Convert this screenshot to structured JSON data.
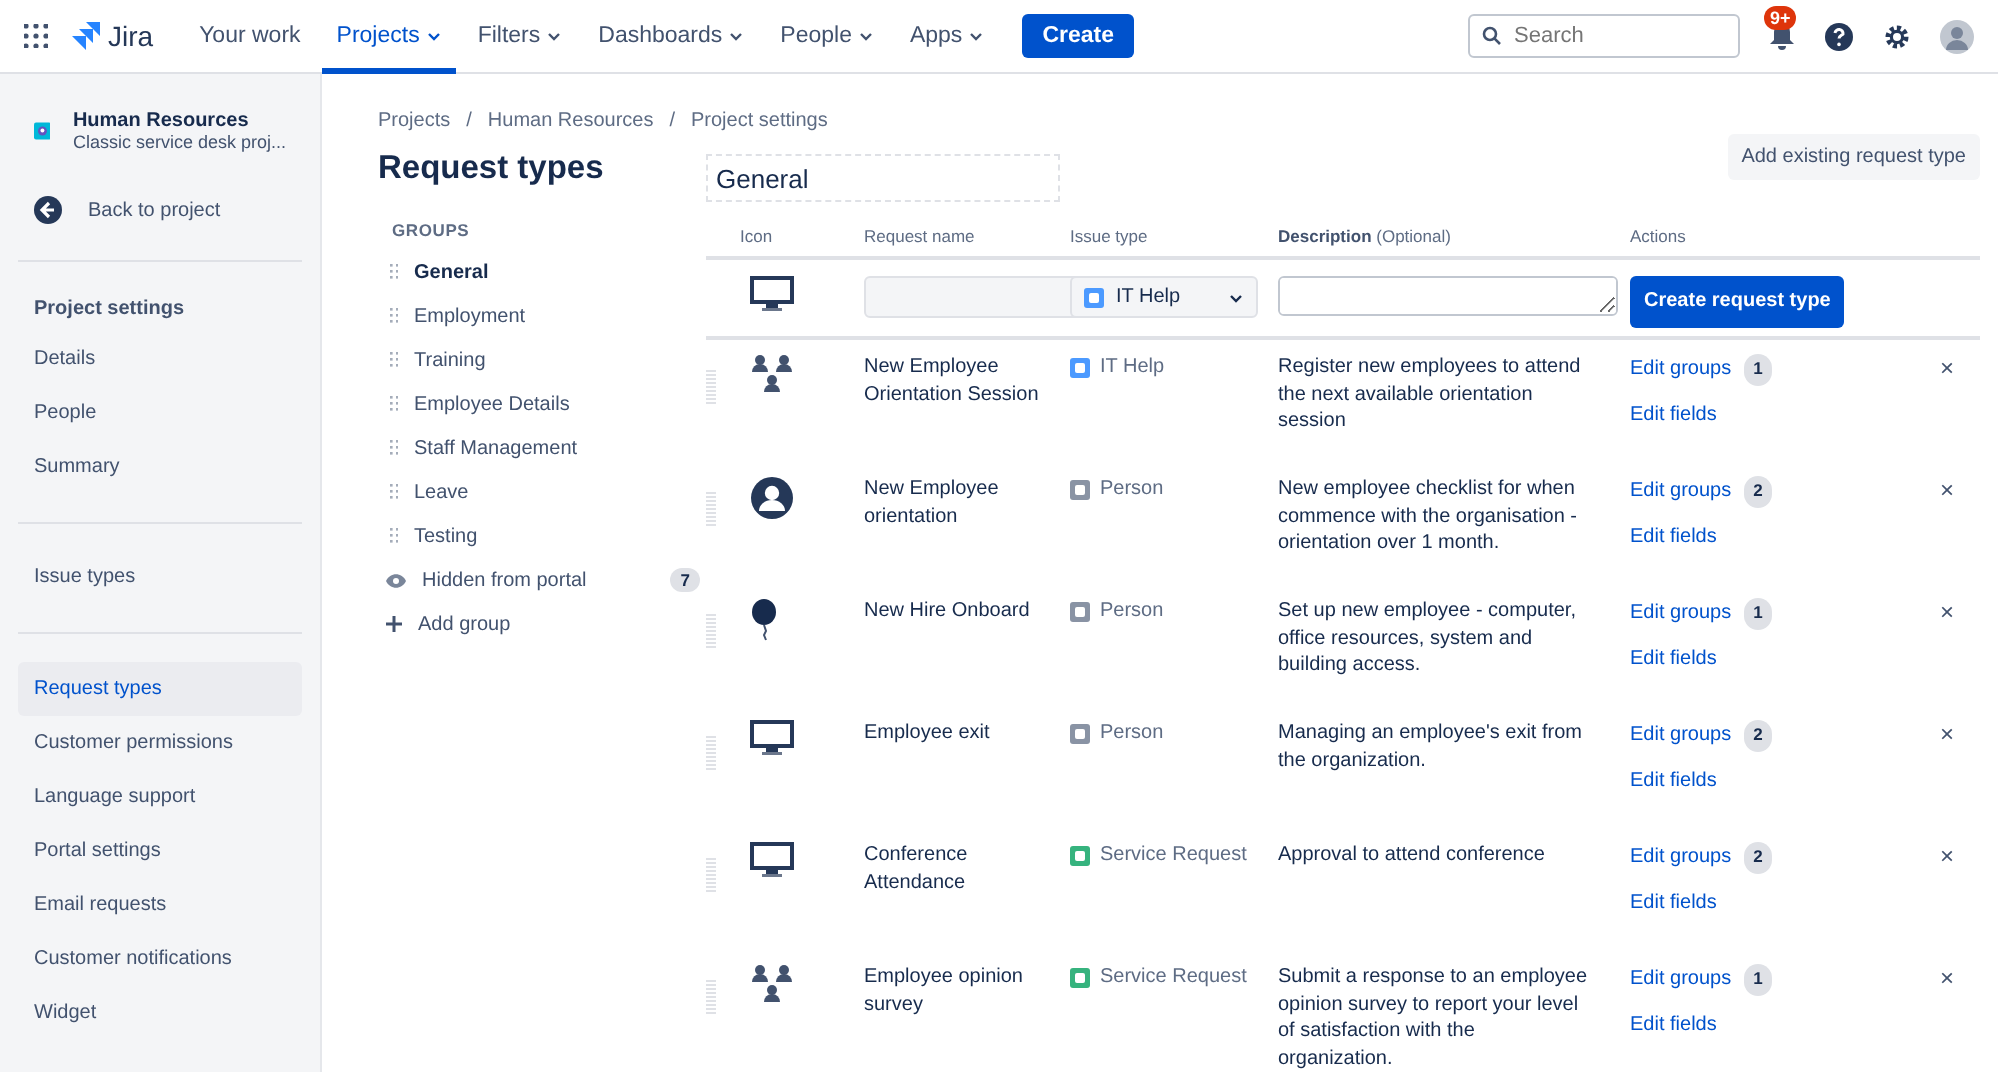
{
  "nav": {
    "logo": "Jira",
    "items": [
      {
        "label": "Your work",
        "selected": false,
        "dropdown": false
      },
      {
        "label": "Projects",
        "selected": true,
        "dropdown": true
      },
      {
        "label": "Filters",
        "selected": false,
        "dropdown": true
      },
      {
        "label": "Dashboards",
        "selected": false,
        "dropdown": true
      },
      {
        "label": "People",
        "selected": false,
        "dropdown": true
      },
      {
        "label": "Apps",
        "selected": false,
        "dropdown": true
      }
    ],
    "create": "Create",
    "search": {
      "placeholder": "Search"
    },
    "notifications_badge": "9+"
  },
  "sidebar": {
    "project": {
      "name": "Human Resources",
      "type": "Classic service desk proj..."
    },
    "back": "Back to project",
    "heading": "Project settings",
    "sections": [
      [
        {
          "label": "Details",
          "selected": false
        },
        {
          "label": "People",
          "selected": false
        },
        {
          "label": "Summary",
          "selected": false
        }
      ],
      [
        {
          "label": "Issue types",
          "selected": false
        }
      ],
      [
        {
          "label": "Request types",
          "selected": true
        },
        {
          "label": "Customer permissions",
          "selected": false
        },
        {
          "label": "Language support",
          "selected": false
        },
        {
          "label": "Portal settings",
          "selected": false
        },
        {
          "label": "Email requests",
          "selected": false
        },
        {
          "label": "Customer notifications",
          "selected": false
        },
        {
          "label": "Widget",
          "selected": false
        }
      ]
    ]
  },
  "breadcrumbs": {
    "separator": "/",
    "items": [
      "Projects",
      "Human Resources",
      "Project settings"
    ]
  },
  "title": "Request types",
  "groups": {
    "heading": "GROUPS",
    "items": [
      {
        "label": "General",
        "selected": true
      },
      {
        "label": "Employment",
        "selected": false
      },
      {
        "label": "Training",
        "selected": false
      },
      {
        "label": "Employee Details",
        "selected": false
      },
      {
        "label": "Staff Management",
        "selected": false
      },
      {
        "label": "Leave",
        "selected": false
      },
      {
        "label": "Testing",
        "selected": false
      }
    ],
    "hidden": {
      "label": "Hidden from portal",
      "count": "7"
    },
    "add": "Add group"
  },
  "group_name": "General",
  "add_existing": "Add existing request type",
  "table": {
    "columns": {
      "icon": "Icon",
      "name": "Request name",
      "issue_type": "Issue type",
      "description": "Description",
      "description_hint": "(Optional)",
      "actions": "Actions"
    },
    "new_row": {
      "kind": "monitor",
      "issue_type": {
        "label": "IT Help",
        "color": "#4c9aff"
      },
      "create": "Create request type"
    },
    "rows": [
      {
        "kind": "people",
        "name": "New Employee Orientation Session",
        "issue_type": {
          "label": "IT Help",
          "color": "#4c9aff"
        },
        "description": "Register new employees to attend the next available orientation session",
        "edit_groups": "Edit groups",
        "count": "1",
        "edit_fields": "Edit fields",
        "remove": "×"
      },
      {
        "kind": "avatar",
        "name": "New Employee orientation",
        "issue_type": {
          "label": "Person",
          "color": "#8993a4"
        },
        "description": "New employee checklist for when commence with the organisation - orientation over 1 month.",
        "edit_groups": "Edit groups",
        "count": "2",
        "edit_fields": "Edit fields",
        "remove": "×"
      },
      {
        "kind": "balloon",
        "name": "New Hire Onboard",
        "issue_type": {
          "label": "Person",
          "color": "#8993a4"
        },
        "description": "Set up new employee - computer, office resources, system and building access.",
        "edit_groups": "Edit groups",
        "count": "1",
        "edit_fields": "Edit fields",
        "remove": "×"
      },
      {
        "kind": "monitor",
        "name": "Employee exit",
        "issue_type": {
          "label": "Person",
          "color": "#8993a4"
        },
        "description": "Managing an employee's exit from the organization.",
        "edit_groups": "Edit groups",
        "count": "2",
        "edit_fields": "Edit fields",
        "remove": "×"
      },
      {
        "kind": "monitor",
        "name": "Conference Attendance",
        "issue_type": {
          "label": "Service Request",
          "color": "#36b37e"
        },
        "description": "Approval to attend conference",
        "edit_groups": "Edit groups",
        "count": "2",
        "edit_fields": "Edit fields",
        "remove": "×"
      },
      {
        "kind": "people",
        "name": "Employee opinion survey",
        "issue_type": {
          "label": "Service Request",
          "color": "#36b37e"
        },
        "description": "Submit a response to an employee opinion survey to report your level of satisfaction with the organization.",
        "edit_groups": "Edit groups",
        "count": "1",
        "edit_fields": "Edit fields",
        "remove": "×"
      }
    ]
  }
}
